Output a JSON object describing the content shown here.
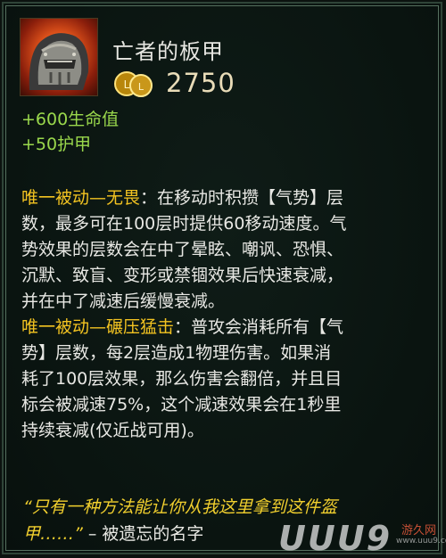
{
  "item": {
    "name": "亡者的板甲",
    "icon": "armor-helmet-icon",
    "cost": "2750",
    "gold_icon": "gold-coin-icon"
  },
  "stats": [
    "+600生命值",
    "+50护甲"
  ],
  "passive1": {
    "label": "唯一被动—无畏",
    "lines": [
      "：在移动时积攒【气势】层",
      "数，最多可在100层时提供60移动速度。气",
      "势效果的层数会在中了晕眩、嘲讽、恐惧、",
      "沉默、致盲、变形或禁锢效果后快速衰减，",
      "并在中了减速后缓慢衰减。"
    ]
  },
  "passive2": {
    "label": "唯一被动—碾压猛击",
    "lines": [
      "：普攻会消耗所有【气",
      "势】层数，每2层造成1物理伤害。如果消",
      "耗了100层效果，那么伤害会翻倍，并且目",
      "标会被减速75%，这个减速效果会在1秒里",
      "持续衰减(仅近战可用)。"
    ]
  },
  "quote": {
    "line1": "“只有一种方法能让你从我这里拿到这件盔",
    "line2": "甲……”",
    "author": " – 被遗忘的名字"
  },
  "watermark": {
    "logo": "UUU9",
    "site": "游久网",
    "url": "www.uuu9.com"
  },
  "colors": {
    "stat_green": "#9ad84c",
    "passive_yellow": "#f3c321",
    "quote_yellow": "#f1cf2e",
    "text": "#e8e8e4",
    "background": "#0a1410"
  }
}
